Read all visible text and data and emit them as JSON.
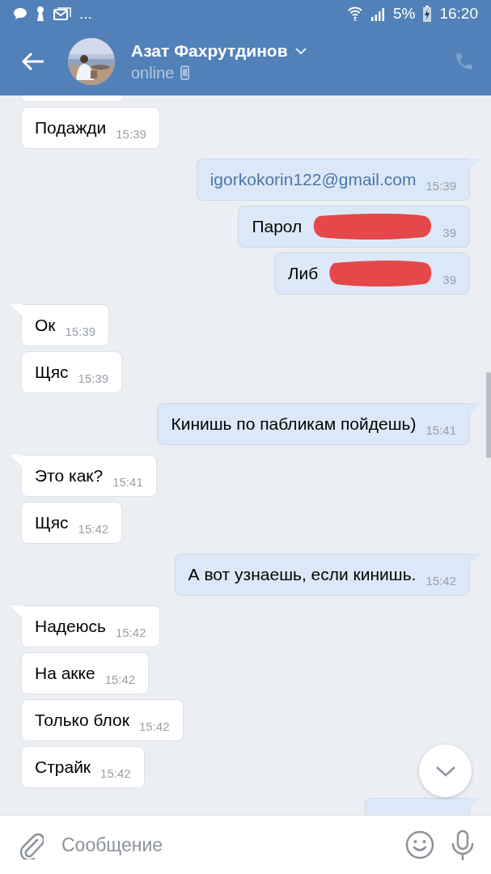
{
  "status_bar": {
    "notification_more": "...",
    "battery_percent": "5%",
    "time": "16:20"
  },
  "header": {
    "name": "Азат Фахрутдинов",
    "status": "online"
  },
  "messages": [
    {
      "kind": "incoming",
      "partial": true,
      "tail": false
    },
    {
      "kind": "incoming",
      "text": "Подажди",
      "time": "15:39",
      "tail": false
    },
    {
      "kind": "outgoing",
      "text": "igorkokorin122@gmail.com",
      "time": "15:39",
      "tail": true,
      "link": true
    },
    {
      "kind": "outgoing",
      "text": "Парол",
      "time": "39",
      "tail": false,
      "redacted": true
    },
    {
      "kind": "outgoing",
      "text": "Либ",
      "time": "39",
      "tail": false,
      "redacted": true
    },
    {
      "kind": "incoming",
      "text": "Ок",
      "time": "15:39",
      "tail": true
    },
    {
      "kind": "incoming",
      "text": "Щяс",
      "time": "15:39",
      "tail": false
    },
    {
      "kind": "outgoing",
      "text": "Кинишь по пабликам пойдешь)",
      "time": "15:41",
      "tail": true
    },
    {
      "kind": "incoming",
      "text": "Это как?",
      "time": "15:41",
      "tail": true
    },
    {
      "kind": "incoming",
      "text": "Щяс",
      "time": "15:42",
      "tail": false
    },
    {
      "kind": "outgoing",
      "text": "А вот узнаешь, если кинишь.",
      "time": "15:42",
      "tail": true
    },
    {
      "kind": "incoming",
      "text": "Надеюсь",
      "time": "15:42",
      "tail": true
    },
    {
      "kind": "incoming",
      "text": "На акке",
      "time": "15:42",
      "tail": false
    },
    {
      "kind": "incoming",
      "text": "Только блок",
      "time": "15:42",
      "tail": false
    },
    {
      "kind": "incoming",
      "text": "Страйк",
      "time": "15:42",
      "tail": false
    },
    {
      "kind": "outgoing",
      "partial": true,
      "tail": true
    }
  ],
  "composer": {
    "placeholder": "Сообщение"
  }
}
